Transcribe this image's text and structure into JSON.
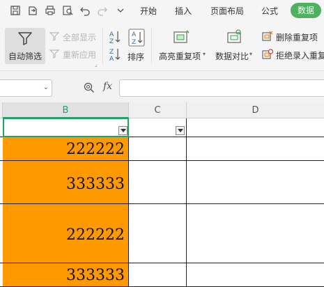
{
  "menu": {
    "items": [
      "开始",
      "插入",
      "页面布局",
      "公式"
    ],
    "active_tab": "数据"
  },
  "ribbon": {
    "autofilter_label": "自动筛选",
    "show_all_label": "全部显示",
    "reapply_label": "重新应用",
    "sort_label": "排序",
    "highlight_dup_label": "高亮重复项",
    "compare_label": "数据对比",
    "remove_dup_label": "删除重复项",
    "reject_dup_label": "拒绝录入重复"
  },
  "formula_bar": {
    "fx_label": "fx",
    "name_box_value": "",
    "formula_value": ""
  },
  "grid": {
    "columns": [
      "B",
      "C",
      "D"
    ],
    "selected_column": "B",
    "rows": [
      {
        "b": ""
      },
      {
        "b": "222222"
      },
      {
        "b": "333333"
      },
      {
        "b": "222222"
      },
      {
        "b": "333333"
      }
    ]
  },
  "colors": {
    "accent": "#4fb15f",
    "selection": "#21a366",
    "cell_fill": "#ff9900"
  }
}
